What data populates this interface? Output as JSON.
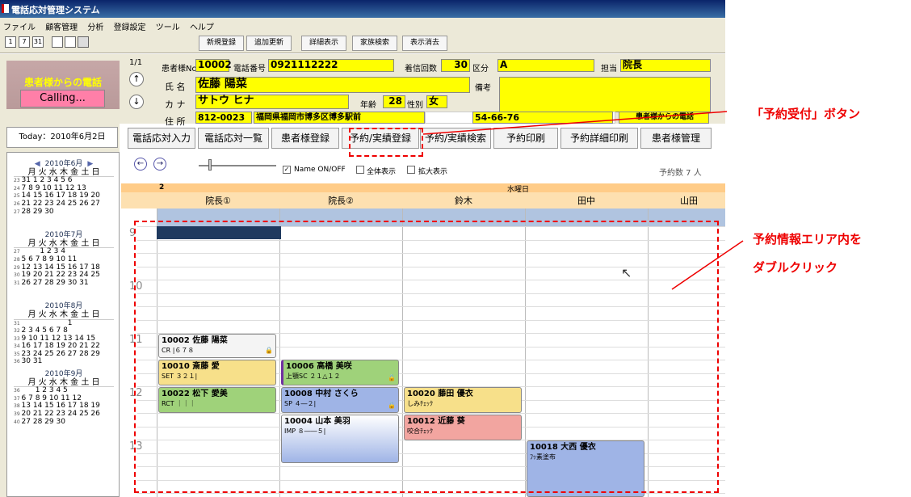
{
  "app": {
    "title": "電話応対管理システム"
  },
  "menu": [
    "ファイル",
    "顧客管理",
    "分析",
    "登録設定",
    "ツール",
    "ヘルプ"
  ],
  "toolbar": {
    "icons": [
      "1",
      "7",
      "31"
    ],
    "buttons": [
      "新規登録",
      "追加更新",
      "詳細表示",
      "家族検索",
      "表示消去"
    ]
  },
  "call": {
    "label": "患者様からの電話",
    "button": "Calling..."
  },
  "today": "Today：2010年6月2日",
  "patient": {
    "page": "1/1",
    "no_label": "患者様No",
    "no": "10002",
    "tel_label": "電話番号",
    "tel": "0921112222",
    "count_label": "着信回数",
    "count": "30",
    "kubun_label": "区分",
    "kubun": "A",
    "tanto_label": "担当",
    "tanto": "院長",
    "name_label": "氏 名",
    "name": "佐藤 陽菜",
    "biko_label": "備考",
    "kana_label": "カ ナ",
    "kana": "サトウ ヒナ",
    "age_label": "年齢",
    "age": "28",
    "sex_label": "性別",
    "sex": "女",
    "addr_label": "住 所",
    "zip": "812-0023",
    "addr": "福岡県福岡市博多区博多駅前",
    "phone2": "54-66-76",
    "call_tag": "患者様からの電話"
  },
  "main_buttons": [
    "電話応対入力",
    "電話応対一覧",
    "患者様登録",
    "予約/実績登録",
    "予約/実績検索",
    "予約印刷",
    "予約詳細印刷",
    "患者様管理"
  ],
  "tools": {
    "name_onoff": "Name ON/OFF",
    "all": "全体表示",
    "zoom": "拡大表示",
    "count": "予約数 7 人"
  },
  "schedule": {
    "date_num": "2",
    "weekday": "水曜日",
    "columns": [
      "院長①",
      "院長②",
      "鈴木",
      "田中",
      "山田"
    ],
    "hours": [
      "9",
      "10",
      "11",
      "12",
      "13"
    ],
    "appointments": [
      {
        "title": "10002 佐藤 陽菜",
        "sub": "CR |６７８",
        "color": "#f4f4f4"
      },
      {
        "title": "10010 斎藤 愛",
        "sub": "SET ３２１|",
        "color": "#f7e08a"
      },
      {
        "title": "10022 松下 愛美",
        "sub": "RCT ｜｜｜",
        "color": "#9fd27a"
      },
      {
        "title": "10006 高橋 美咲",
        "sub": "上顎SC ２１△１２",
        "color": "#9fd27a"
      },
      {
        "title": "10008 中村 さくら",
        "sub": "SP ４―２|",
        "color": "#9fb4e6"
      },
      {
        "title": "10004 山本 美羽",
        "sub": "IMP ８――５|",
        "color": "#ffffff"
      },
      {
        "title": "10020 藤田 優衣",
        "sub": "しみﾁｪｯｸ",
        "color": "#f7e08a"
      },
      {
        "title": "10012 近藤 葵",
        "sub": "咬合ﾁｪｯｸ",
        "color": "#f2a5a0"
      },
      {
        "title": "10018 大西 優衣",
        "sub": "ﾌｯ素塗布",
        "color": "#9fb4e6"
      }
    ]
  },
  "calendar": [
    {
      "title": "2010年6月",
      "week": "月火水木金土日",
      "rows": [
        [
          "23",
          "31 1 2 3 4 5 6"
        ],
        [
          "24",
          "7 8 9 10 11 12 13"
        ],
        [
          "25",
          "14 15 16 17 18 19 20"
        ],
        [
          "26",
          "21 22 23 24 25 26 27"
        ],
        [
          "27",
          "28 29 30"
        ]
      ]
    },
    {
      "title": "2010年7月",
      "week": "月火水木金土日",
      "rows": [
        [
          "27",
          "        1 2 3 4"
        ],
        [
          "28",
          "5 6 7 8 9 10 11"
        ],
        [
          "29",
          "12 13 14 15 16 17 18"
        ],
        [
          "30",
          "19 20 21 22 23 24 25"
        ],
        [
          "31",
          "26 27 28 29 30 31"
        ]
      ]
    },
    {
      "title": "2010年8月",
      "week": "月火水木金土日",
      "rows": [
        [
          "31",
          "                    1"
        ],
        [
          "32",
          "2 3 4 5 6 7 8"
        ],
        [
          "33",
          "9 10 11 12 13 14 15"
        ],
        [
          "34",
          "16 17 18 19 20 21 22"
        ],
        [
          "35",
          "23 24 25 26 27 28 29"
        ],
        [
          "36",
          "30 31"
        ]
      ]
    },
    {
      "title": "2010年9月",
      "week": "月火水木金土日",
      "rows": [
        [
          "36",
          "      1 2 3 4 5"
        ],
        [
          "37",
          "6 7 8 9 10 11 12"
        ],
        [
          "38",
          "13 14 15 16 17 18 19"
        ],
        [
          "39",
          "20 21 22 23 24 25 26"
        ],
        [
          "40",
          "27 28 29 30"
        ]
      ]
    }
  ],
  "annotations": {
    "button": "「予約受付」ボタン",
    "area1": "予約情報エリア内を",
    "area2": "ダブルクリック"
  }
}
